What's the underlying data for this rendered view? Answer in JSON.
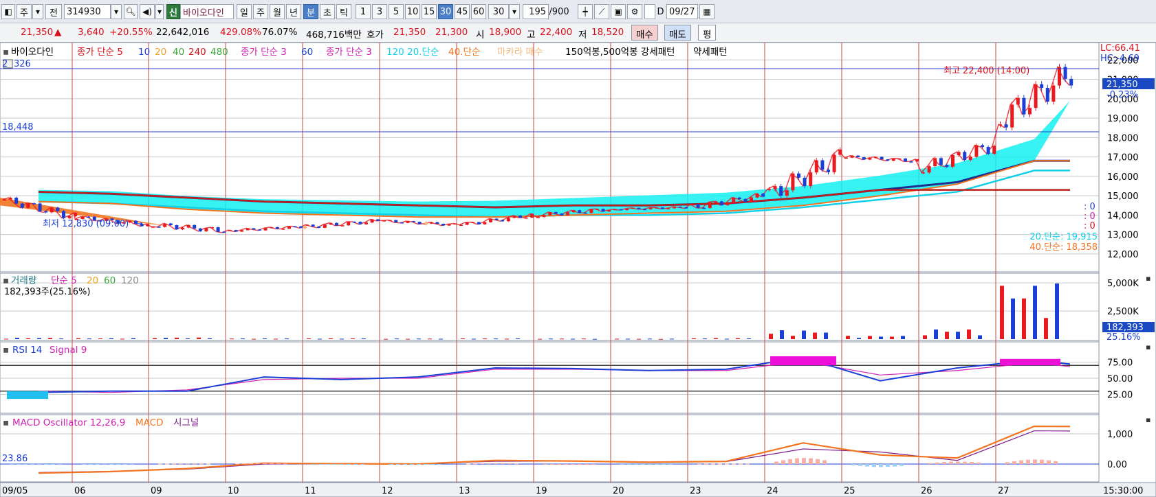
{
  "toolbar": {
    "period_d": "주",
    "prev": "전",
    "code": "314930",
    "shin": "신",
    "name": "바이오다인",
    "day": "일",
    "week": "주",
    "month": "월",
    "year": "년",
    "minute": "분",
    "second": "초",
    "tick": "틱",
    "intervals": [
      "1",
      "3",
      "5",
      "10",
      "15",
      "30",
      "45",
      "60"
    ],
    "interval_select": "30",
    "count": "195",
    "count_total": "/900",
    "date": "09/27",
    "date_prefix": "D"
  },
  "quote": {
    "price": "21,350",
    "up_arrow": "▲",
    "change": "3,640",
    "change_pct": "+20.55%",
    "volume": "22,642,016",
    "vol_ratio": "429.08%",
    "turnover": "76.07%",
    "amount": "468,716백만",
    "hoga_label": "호가",
    "ask": "21,350",
    "bid": "21,300",
    "open_label": "시",
    "open": "18,900",
    "high_label": "고",
    "high": "22,400",
    "low_label": "저",
    "low": "18,520",
    "buy_btn": "매수",
    "sell_btn": "매도",
    "eval_btn": "평"
  },
  "price_panel": {
    "legend": {
      "name": "바이오다인",
      "close_simple_5": "종가 단순 5",
      "p10": "10",
      "p20": "20",
      "p40": "40",
      "p240": "240",
      "p480": "480",
      "close_simple_3": "종가 단순 3",
      "p60": "60",
      "close_simple_3b": "종가 단순 3",
      "p120": "120",
      "sma20": "20.단순",
      "sma40": "40.단순",
      "macarrah": "마카라 매수",
      "pattern1": "150억봉,500억봉 강세패턴",
      "pattern2": "약세패턴"
    },
    "hline_top_label": "2",
    "hline_top_value": "326",
    "hline_mid_value": "18,448",
    "max_label": "최고 22,400 (14:00)",
    "min_label": "최저 12,830 (09:00)",
    "lc_label": "LC:66.41",
    "hc_label": "HC:-4.69",
    "current_price": "21,350",
    "current_pct": "-0.23%",
    "side_zeros": [
      ": 0",
      ": 0",
      ": 0"
    ],
    "sma20_label": "20.단순: 19,915",
    "sma40_label": "40.단순: 18,358",
    "y_ticks": [
      "22,000",
      "21,000",
      "20,000",
      "19,000",
      "18,000",
      "17,000",
      "16,000",
      "15,000",
      "14,000",
      "13,000",
      "12,000"
    ]
  },
  "volume_panel": {
    "legend_name": "거래량",
    "legend_simple5": "단순 5",
    "p20": "20",
    "p60": "60",
    "p120": "120",
    "info": "182,393주(25.16%)",
    "y_ticks": [
      "5,000K",
      "2,500K"
    ],
    "current": "182,393",
    "current_pct": "25.16%"
  },
  "rsi_panel": {
    "legend_rsi": "RSI 14",
    "legend_signal": "Signal 9",
    "y_ticks": [
      "75.00",
      "50.00",
      "25.00"
    ]
  },
  "macd_panel": {
    "legend_osc": "MACD Oscillator 12,26,9",
    "legend_macd": "MACD",
    "legend_signal": "시그널",
    "left_value": "23.86",
    "y_ticks": [
      "1,000",
      "0.00"
    ]
  },
  "x_axis": {
    "labels": [
      "09/05",
      "06",
      "09",
      "10",
      "11",
      "12",
      "13",
      "19",
      "20",
      "23",
      "24",
      "25",
      "26",
      "27"
    ],
    "time": "15:30:00"
  },
  "colors": {
    "up": "#e8191f",
    "down": "#1a3fd6",
    "sma5": "#e8191f",
    "sma10": "#1a3fd6",
    "sma20": "#f0a020",
    "sma40": "#3aa83a",
    "sma60": "#d021b4",
    "sma120": "#10e0f0",
    "cloud": "#14f0f0",
    "cloud2": "#f37420",
    "navy": "#1c2b8c",
    "grid": "#c9c9c9",
    "vline": "#c44a4a"
  },
  "chart_data": [
    {
      "type": "candlestick",
      "title": "바이오다인",
      "x": [
        "09/05",
        "06",
        "09",
        "10",
        "11",
        "12",
        "13",
        "19",
        "20",
        "23",
        "24",
        "25",
        "26",
        "27"
      ],
      "ylim": [
        11500,
        22400
      ],
      "ohlc": [
        [
          14800,
          14900,
          13700,
          13900
        ],
        [
          13900,
          14000,
          13400,
          13500
        ],
        [
          13500,
          13600,
          12830,
          13200
        ],
        [
          13200,
          13500,
          13100,
          13400
        ],
        [
          13400,
          13900,
          13300,
          13700
        ],
        [
          13700,
          13800,
          13400,
          13500
        ],
        [
          13500,
          14100,
          13500,
          14000
        ],
        [
          14000,
          14500,
          13900,
          14300
        ],
        [
          14300,
          14500,
          14200,
          14400
        ],
        [
          14400,
          15200,
          14300,
          15000
        ],
        [
          15000,
          17800,
          15000,
          17000
        ],
        [
          17000,
          17100,
          16600,
          16800
        ],
        [
          16400,
          18100,
          16200,
          17600
        ],
        [
          18900,
          22400,
          18520,
          21350
        ]
      ],
      "series": [
        {
          "name": "20.단순",
          "values": [
            14700,
            14600,
            14300,
            14100,
            14000,
            13900,
            13900,
            14000,
            14100,
            14200,
            14500,
            15000,
            15600,
            16800
          ]
        },
        {
          "name": "40.단순",
          "values": [
            14900,
            14800,
            14600,
            14400,
            14300,
            14200,
            14100,
            14200,
            14200,
            14300,
            14600,
            15000,
            15400,
            16500
          ]
        }
      ]
    },
    {
      "type": "bar",
      "title": "거래량",
      "categories": [
        "09/05",
        "06",
        "09",
        "10",
        "11",
        "12",
        "13",
        "19",
        "20",
        "23",
        "24",
        "25",
        "26",
        "27"
      ],
      "values": [
        120,
        80,
        140,
        60,
        70,
        50,
        60,
        50,
        40,
        90,
        800,
        300,
        900,
        5000
      ],
      "ylim": [
        0,
        5500
      ]
    },
    {
      "type": "line",
      "title": "RSI",
      "x": [
        "09/05",
        "06",
        "09",
        "10",
        "11",
        "12",
        "13",
        "19",
        "20",
        "23",
        "24",
        "25",
        "26",
        "27"
      ],
      "series": [
        {
          "name": "RSI 14",
          "values": [
            28,
            30,
            30,
            52,
            48,
            52,
            66,
            65,
            62,
            64,
            82,
            46,
            66,
            78
          ]
        },
        {
          "name": "Signal 9",
          "values": [
            30,
            28,
            32,
            48,
            50,
            50,
            64,
            64,
            62,
            62,
            76,
            55,
            62,
            74
          ]
        }
      ],
      "ylim": [
        0,
        100
      ]
    },
    {
      "type": "line",
      "title": "MACD",
      "x": [
        "09/05",
        "06",
        "09",
        "10",
        "11",
        "12",
        "13",
        "19",
        "20",
        "23",
        "24",
        "25",
        "26",
        "27"
      ],
      "series": [
        {
          "name": "MACD",
          "values": [
            -300,
            -250,
            -150,
            30,
            10,
            0,
            120,
            100,
            60,
            90,
            700,
            300,
            200,
            1250
          ]
        },
        {
          "name": "시그널",
          "values": [
            -280,
            -240,
            -170,
            0,
            20,
            10,
            90,
            100,
            70,
            80,
            500,
            400,
            120,
            1100
          ]
        }
      ],
      "ylim": [
        -500,
        1500
      ]
    }
  ]
}
